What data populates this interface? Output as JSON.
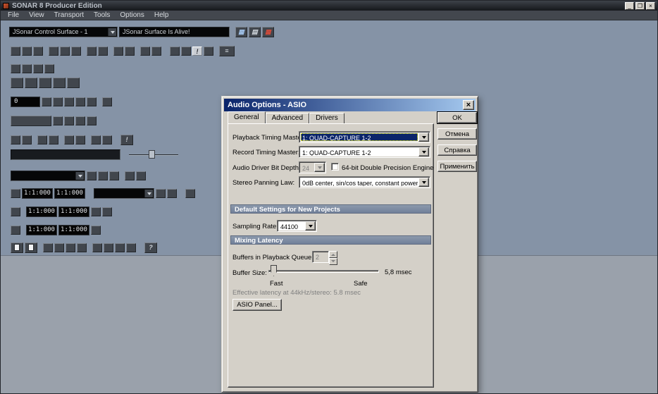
{
  "window": {
    "title": "SONAR 8 Producer Edition",
    "menu": [
      "File",
      "View",
      "Transport",
      "Tools",
      "Options",
      "Help"
    ]
  },
  "icons": {
    "minimize": "_",
    "restore": "❐",
    "close": "×",
    "dialog_close": "×",
    "alert": "!",
    "help": "?",
    "menu_list": "≡",
    "grid": "▦",
    "layers": "▤",
    "disconnect": "▦"
  },
  "toolbars": {
    "control_surface_value": "JSonar Control Surface - 1",
    "surface_status": "JSonar Surface Is Alive!",
    "counter_value": "0",
    "times": [
      "1:1:000",
      "1:1:000",
      "1:1:000",
      "1:1:000",
      "1:1:000",
      "1:1:000"
    ]
  },
  "dialog": {
    "title": "Audio Options - ASIO",
    "tabs": [
      "General",
      "Advanced",
      "Drivers"
    ],
    "active_tab": "General",
    "fields": {
      "playback_label": "Playback Timing Master:",
      "playback_value": "1: QUAD-CAPTURE 1-2",
      "record_label": "Record Timing Master:",
      "record_value": "1: QUAD-CAPTURE 1-2",
      "bit_depth_label": "Audio Driver Bit Depth:",
      "bit_depth_value": "24",
      "precision_label": "64-bit Double Precision Engine",
      "precision_checked": false,
      "panning_label": "Stereo Panning Law:",
      "panning_value": "0dB center, sin/cos taper, constant power",
      "sampling_label": "Sampling Rate:",
      "sampling_value": "44100",
      "buffers_label": "Buffers in Playback Queue:",
      "buffers_value": "2",
      "buffer_size_label": "Buffer Size:",
      "buffer_size_value": "5,8 msec",
      "fast": "Fast",
      "safe": "Safe",
      "effective_latency": "Effective latency at 44kHz/stereo: 5.8 msec"
    },
    "sections": {
      "defaults": "Default Settings for New Projects",
      "mixing": "Mixing Latency"
    },
    "buttons": {
      "ok": "OK",
      "cancel": "Отмена",
      "help": "Справка",
      "apply": "Применить",
      "asio_panel": "ASIO Panel..."
    }
  },
  "colors": {
    "workspace_bg": "#8593a6",
    "client_bg": "#9aa1ab",
    "dialog_face": "#d4d0c8",
    "dialog_title_start": "#0a246a",
    "dialog_title_end": "#a6caf0",
    "selection_bg": "#0a246a",
    "section_header_bg": "#7b8699"
  }
}
